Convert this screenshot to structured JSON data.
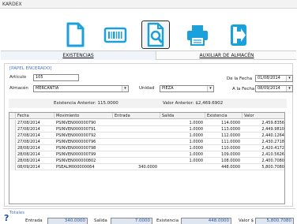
{
  "window": {
    "title": "KARDEX"
  },
  "toolbar": {
    "buttons": [
      {
        "name": "document-icon"
      },
      {
        "name": "barcode-icon"
      },
      {
        "name": "search-document-icon"
      },
      {
        "name": "printer-icon"
      },
      {
        "name": "exit-icon"
      }
    ]
  },
  "tabs": [
    {
      "label": "EXISTENCIAS"
    },
    {
      "label": "AUXILIAR DE ALMACÉN"
    }
  ],
  "form": {
    "product_name": "[PAPEL ENCERADO]",
    "articulo_label": "Artículo",
    "articulo_value": "105",
    "almacen_label": "Almacén",
    "almacen_value": "MERCANTIA",
    "unidad_label": "Unidad",
    "unidad_value": "PIEZA",
    "de_fecha_label": "De la Fecha",
    "de_fecha_value": "01/08/2014",
    "a_fecha_label": "A la Fecha",
    "a_fecha_value": "08/09/2014"
  },
  "summary": {
    "existencia_anterior": "Existencia Anterior: 115.0000",
    "valor_anterior": "Valor Anterior: $2,469.6902"
  },
  "table": {
    "columns": [
      "Fecha",
      "Movimiento",
      "Entrada",
      "Salida",
      "Existencia",
      "Valor"
    ],
    "rows": [
      [
        "27/08/2014",
        "PSINVEN000000790",
        "",
        "1.0000",
        "114.0000",
        "2,459.8356"
      ],
      [
        "27/08/2014",
        "PSINVEN000000791",
        "",
        "1.0000",
        "113.0000",
        "2,449.9810"
      ],
      [
        "27/08/2014",
        "PSINVEN000000792",
        "",
        "1.0000",
        "112.0000",
        "2,440.1264"
      ],
      [
        "27/08/2014",
        "PSINVEN000000796",
        "",
        "1.0000",
        "111.0000",
        "2,430.2718"
      ],
      [
        "28/08/2014",
        "PSINVEN000000798",
        "",
        "1.0000",
        "110.0000",
        "2,420.4172"
      ],
      [
        "28/08/2014",
        "PSINVEN000000799",
        "",
        "1.0000",
        "109.0000",
        "2,410.5626"
      ],
      [
        "28/08/2014",
        "PSINVEN000000802",
        "",
        "1.0000",
        "108.0000",
        "2,400.7080"
      ],
      [
        "08/09/2014",
        "PSEALM000000064",
        "340.0000",
        "",
        "448.0000",
        "5,800.7080"
      ]
    ]
  },
  "totals": {
    "title": "Totales",
    "entrada_label": "Entrada",
    "entrada_value": "340.0000",
    "salida_label": "Salida",
    "salida_value": "7.0000",
    "existencia_label": "Existencia",
    "existencia_value": "448.0000",
    "valor_label": "Valor $",
    "valor_value": "5,800.7080"
  },
  "help": {
    "label": "?"
  },
  "colors": {
    "accent": "#1aa0db",
    "accent_dark": "#0e6fa8",
    "label_blue": "#4a78b8",
    "totals_fill": "#dfe6f2"
  }
}
